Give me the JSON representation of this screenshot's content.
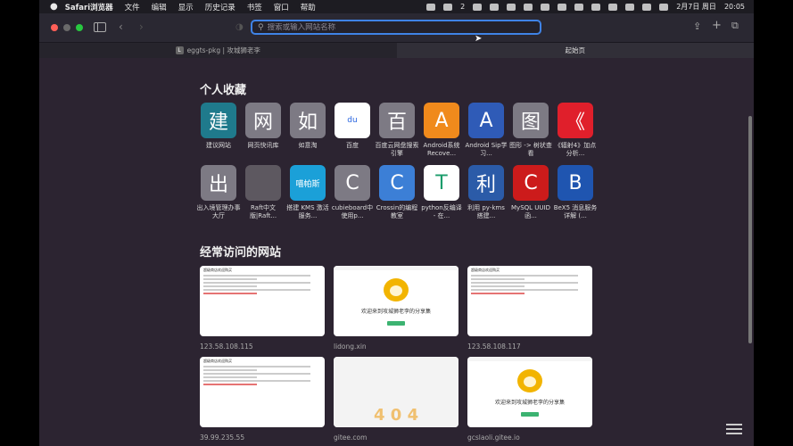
{
  "menubar": {
    "apple": "",
    "app_name": "Safari浏览器",
    "items": [
      "文件",
      "编辑",
      "显示",
      "历史记录",
      "书签",
      "窗口",
      "帮助"
    ],
    "status_count": "2",
    "date": "2月7日 周日",
    "time": "20:05"
  },
  "toolbar": {
    "search_placeholder": "搜索或输入网站名称",
    "search_value": ""
  },
  "tabs": [
    {
      "favicon": "L",
      "label": "eggts-pkg | 攻城狮老李"
    },
    {
      "favicon": "",
      "label": "起始页"
    }
  ],
  "favorites": {
    "title": "个人收藏",
    "items": [
      {
        "glyph": "建",
        "label": "建议网站",
        "color": "#1f7a8c"
      },
      {
        "glyph": "网",
        "label": "网页快讯库",
        "color": "#7d7a84"
      },
      {
        "glyph": "如",
        "label": "如意淘",
        "color": "#7d7a84"
      },
      {
        "glyph": "du",
        "label": "百度",
        "color": "#ffffff"
      },
      {
        "glyph": "百",
        "label": "百度云网盘搜索引擎",
        "color": "#7d7a84"
      },
      {
        "glyph": "A",
        "label": "Android系统 Recove...",
        "color": "#f08a1c"
      },
      {
        "glyph": "A",
        "label": "Android Sip学习...",
        "color": "#2f5bb7"
      },
      {
        "glyph": "图",
        "label": "图形 -> 树状查看",
        "color": "#7d7a84"
      },
      {
        "glyph": "《",
        "label": "《辐射4》加点分析...",
        "color": "#e01f2b"
      },
      {
        "glyph": "出",
        "label": "出入境管理办事大厅",
        "color": "#7d7a84"
      },
      {
        "glyph": "",
        "label": "Raft中文版|Raft...",
        "color": "#5d5860"
      },
      {
        "glyph": "喵帕斯",
        "label": "搭建 KMS 激活服务...",
        "color": "#1ba0d8"
      },
      {
        "glyph": "C",
        "label": "cubieboard中使用p...",
        "color": "#7d7a84"
      },
      {
        "glyph": "C",
        "label": "Crossin的编程教室",
        "color": "#3c7fd6"
      },
      {
        "glyph": "T",
        "label": "python反编译 - 在...",
        "color": "#ffffff"
      },
      {
        "glyph": "利",
        "label": "利用 py-kms 搭建...",
        "color": "#2b5ba8"
      },
      {
        "glyph": "C",
        "label": "MySQL UUID函...",
        "color": "#cc1b1b"
      },
      {
        "glyph": "B",
        "label": "BeX5 消息服务详解 (...",
        "color": "#1f55b0"
      }
    ]
  },
  "frequent": {
    "title": "经常访问的网站",
    "items": [
      {
        "url": "123.58.108.115",
        "thumb_title": "超级商店欢迎购买",
        "kind": "text"
      },
      {
        "url": "lidong.xin",
        "welcome": "欢迎来到攻城狮老李的分享集",
        "kind": "lion"
      },
      {
        "url": "123.58.108.117",
        "thumb_title": "超级商店欢迎购买",
        "kind": "text"
      },
      {
        "url": "39.99.235.55",
        "thumb_title": "超级商店欢迎购买",
        "kind": "text"
      },
      {
        "url": "gitee.com",
        "big": "4 0 4",
        "kind": "gitee"
      },
      {
        "url": "gcslaoli.gitee.io",
        "welcome": "欢迎来到攻城狮老李的分享集",
        "kind": "lion"
      }
    ]
  },
  "colors": {
    "accent": "#3f83e6",
    "background": "#2c2431"
  }
}
